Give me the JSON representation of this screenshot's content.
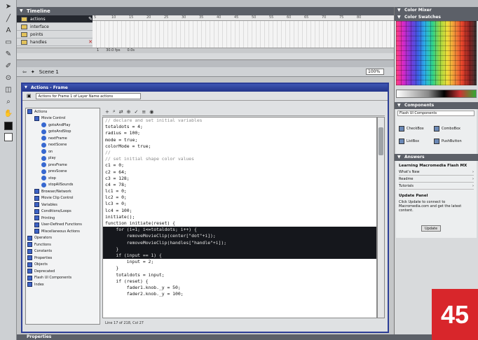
{
  "timeline": {
    "title": "Timeline",
    "layers": [
      {
        "name": "actions",
        "selected": true
      },
      {
        "name": "interface",
        "selected": false
      },
      {
        "name": "points",
        "selected": false
      },
      {
        "name": "handles",
        "selected": false
      }
    ],
    "ruler": [
      "5",
      "10",
      "15",
      "20",
      "25",
      "30",
      "35",
      "40",
      "45",
      "50",
      "55",
      "60",
      "65",
      "70",
      "75",
      "80"
    ],
    "frame_bar": [
      "1",
      "30.0 fps",
      "0.0s"
    ]
  },
  "scene": {
    "label": "Scene 1",
    "zoom": "100%"
  },
  "actions_panel": {
    "title": "Actions - Frame",
    "target": "Actions for Frame 1 of Layer Name actions",
    "status": "Line 17 of 218, Col 27",
    "tree": [
      {
        "level": 1,
        "icon": "book",
        "label": "Actions"
      },
      {
        "level": 2,
        "icon": "book",
        "label": "Movie Control"
      },
      {
        "level": 3,
        "icon": "fn",
        "label": "gotoAndPlay"
      },
      {
        "level": 3,
        "icon": "fn",
        "label": "gotoAndStop"
      },
      {
        "level": 3,
        "icon": "fn",
        "label": "nextFrame"
      },
      {
        "level": 3,
        "icon": "fn",
        "label": "nextScene"
      },
      {
        "level": 3,
        "icon": "fn",
        "label": "on"
      },
      {
        "level": 3,
        "icon": "fn",
        "label": "play"
      },
      {
        "level": 3,
        "icon": "fn",
        "label": "prevFrame"
      },
      {
        "level": 3,
        "icon": "fn",
        "label": "prevScene"
      },
      {
        "level": 3,
        "icon": "fn",
        "label": "stop"
      },
      {
        "level": 3,
        "icon": "fn",
        "label": "stopAllSounds"
      },
      {
        "level": 2,
        "icon": "book",
        "label": "Browser/Network"
      },
      {
        "level": 2,
        "icon": "book",
        "label": "Movie Clip Control"
      },
      {
        "level": 2,
        "icon": "book",
        "label": "Variables"
      },
      {
        "level": 2,
        "icon": "book",
        "label": "Conditions/Loops"
      },
      {
        "level": 2,
        "icon": "book",
        "label": "Printing"
      },
      {
        "level": 2,
        "icon": "book",
        "label": "User-Defined Functions"
      },
      {
        "level": 2,
        "icon": "book",
        "label": "Miscellaneous Actions"
      },
      {
        "level": 1,
        "icon": "book",
        "label": "Operators"
      },
      {
        "level": 1,
        "icon": "book",
        "label": "Functions"
      },
      {
        "level": 1,
        "icon": "book",
        "label": "Constants"
      },
      {
        "level": 1,
        "icon": "book",
        "label": "Properties"
      },
      {
        "level": 1,
        "icon": "book",
        "label": "Objects"
      },
      {
        "level": 1,
        "icon": "book",
        "label": "Deprecated"
      },
      {
        "level": 1,
        "icon": "book",
        "label": "Flash UI Components"
      },
      {
        "level": 1,
        "icon": "book",
        "label": "Index"
      }
    ],
    "code": [
      {
        "text": "// declare and set initial variables",
        "type": "cmt"
      },
      {
        "text": "totaldots = 4;",
        "type": ""
      },
      {
        "text": "radius = 100;",
        "type": ""
      },
      {
        "text": "mode = true;",
        "type": ""
      },
      {
        "text": "colorMode = true;",
        "type": ""
      },
      {
        "text": "//",
        "type": "cmt"
      },
      {
        "text": "// set initial shape color values",
        "type": "cmt"
      },
      {
        "text": "c1 = 0;",
        "type": ""
      },
      {
        "text": "c2 = 64;",
        "type": ""
      },
      {
        "text": "c3 = 128;",
        "type": ""
      },
      {
        "text": "c4 = 78;",
        "type": ""
      },
      {
        "text": "lc1 = 0;",
        "type": ""
      },
      {
        "text": "lc2 = 0;",
        "type": ""
      },
      {
        "text": "lc3 = 0;",
        "type": ""
      },
      {
        "text": "lc4 = 100;",
        "type": ""
      },
      {
        "text": "initiate();",
        "type": ""
      },
      {
        "text": "function initiate(reset) {",
        "type": ""
      },
      {
        "text": "    for (i=1; i<=totaldots; i++) {",
        "type": "hl"
      },
      {
        "text": "        removeMovieClip(center[\"dot\"+i]);",
        "type": "hl"
      },
      {
        "text": "        removeMovieClip(handles[\"handle\"+i]);",
        "type": "hl"
      },
      {
        "text": "    }",
        "type": "hl"
      },
      {
        "text": "    if (input == 1) {",
        "type": "hl"
      },
      {
        "text": "        input = 2;",
        "type": ""
      },
      {
        "text": "    }",
        "type": ""
      },
      {
        "text": "    totaldots = input;",
        "type": ""
      },
      {
        "text": "    if (reset) {",
        "type": ""
      },
      {
        "text": "        fader1.knob._y = 50;",
        "type": ""
      },
      {
        "text": "        fader2.knob._y = 100;",
        "type": ""
      }
    ]
  },
  "color_mixer": {
    "title": "Color Mixer"
  },
  "color_swatches": {
    "title": "Color Swatches"
  },
  "components": {
    "title": "Components",
    "dropdown": "Flash UI Components",
    "items": [
      "CheckBox",
      "ComboBox",
      "ListBox",
      "PushButton"
    ]
  },
  "answers": {
    "title": "Answers",
    "heading": "Learning Macromedia Flash MX",
    "rows": [
      "What's New",
      "Readme",
      "Tutorials"
    ],
    "update_heading": "Update Panel",
    "update_text": "Click Update to connect to Macromedia.com and get the latest content.",
    "update_button": "Update"
  },
  "properties": {
    "title": "Properties"
  },
  "page_number": "45"
}
